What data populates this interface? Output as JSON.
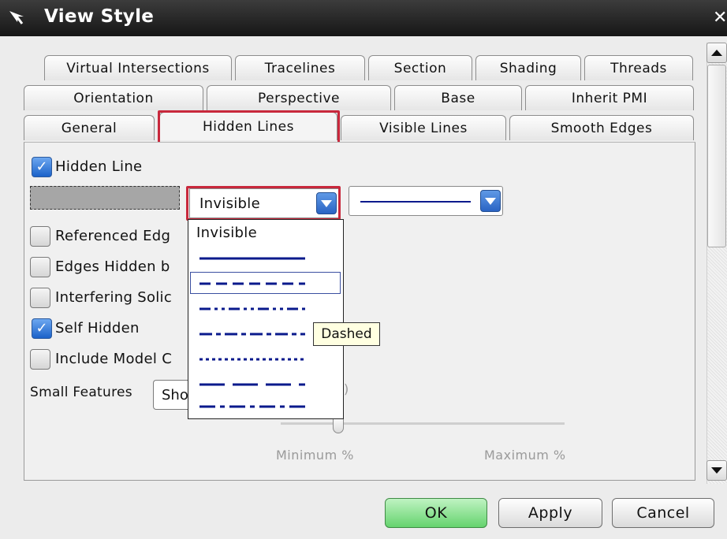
{
  "window": {
    "title": "View Style"
  },
  "tabs": {
    "row1": [
      "Virtual Intersections",
      "Tracelines",
      "Section",
      "Shading",
      "Threads"
    ],
    "row2": [
      "Orientation",
      "Perspective",
      "Base",
      "Inherit PMI"
    ],
    "row3": [
      "General",
      "Hidden Lines",
      "Visible Lines",
      "Smooth Edges"
    ],
    "active": "Hidden Lines"
  },
  "hidden_lines": {
    "hidden_line": {
      "label": "Hidden Line",
      "checked": true
    },
    "color_swatch": "#a6a6a6",
    "line_font_value": "Invisible",
    "options": [
      {
        "label": "Referenced Edg",
        "checked": false
      },
      {
        "label": "Edges Hidden b",
        "checked": false
      },
      {
        "label": "Interfering Solic",
        "checked": false
      },
      {
        "label": "Self Hidden",
        "checked": true
      },
      {
        "label": "Include Model C",
        "checked": false
      }
    ],
    "small_features": {
      "label": "Small Features",
      "value": "Sho"
    },
    "slider": {
      "min_label": "Minimum %",
      "max_label": "Maximum %",
      "partial_value": ")"
    }
  },
  "dropdown": {
    "items": [
      "Invisible",
      "solid",
      "dashed",
      "phantom",
      "centerline",
      "dotted",
      "long-dashed",
      "dash-dot"
    ],
    "highlighted_index": 2,
    "tooltip": "Dashed"
  },
  "buttons": {
    "ok": "OK",
    "apply": "Apply",
    "cancel": "Cancel"
  },
  "colors": {
    "accent_highlight": "#c8283c",
    "line_blue": "#0a1a8c",
    "ok_green": "#65d36e"
  }
}
